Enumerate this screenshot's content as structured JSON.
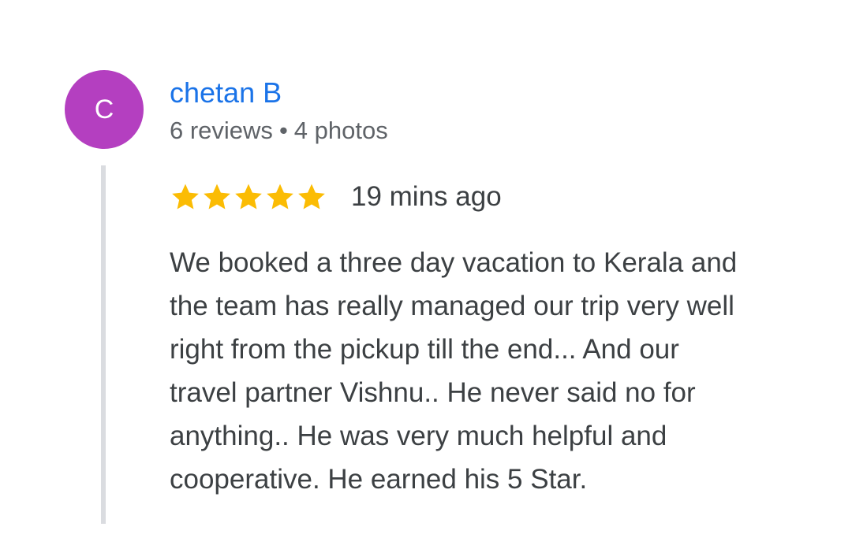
{
  "reviewer": {
    "avatar_letter": "C",
    "avatar_color": "#b43fc0",
    "name": "chetan B",
    "reviews": "6 reviews",
    "separator": "•",
    "photos": "4 photos"
  },
  "review": {
    "rating": 5,
    "rating_max": 5,
    "star_color": "#fbbc04",
    "star_icon": "star-icon",
    "timestamp": "19 mins ago",
    "text_lines": [
      "We booked a three day vacation to Kerala and",
      "the team has really managed our trip very well",
      "right from the pickup till the end... And our",
      "travel partner Vishnu.. He never said no for",
      "anything.. He was very much helpful and",
      "cooperative. He earned his 5 Star."
    ]
  },
  "colors": {
    "name_link": "#1a73e8",
    "meta_text": "#5f6368",
    "body_text": "#3c4043",
    "thread_bar": "#dadce0"
  }
}
